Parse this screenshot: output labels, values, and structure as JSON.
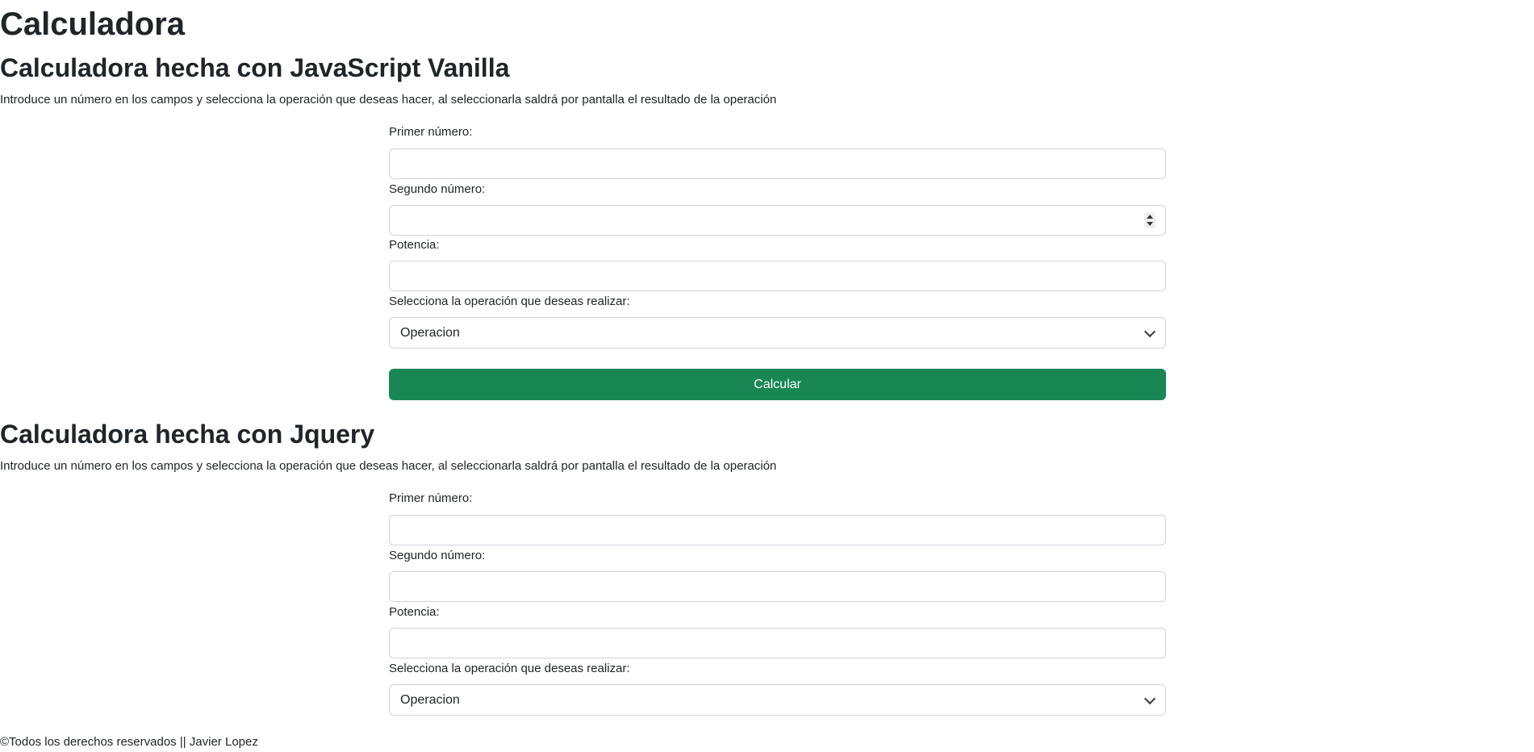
{
  "page": {
    "title": "Calculadora"
  },
  "vanilla": {
    "heading": "Calculadora hecha con JavaScript Vanilla",
    "description": "Introduce un número en los campos y selecciona la operación que deseas hacer, al seleccionarla saldrá por pantalla el resultado de la operación",
    "first_label": "Primer número:",
    "first_value": "",
    "second_label": "Segundo número:",
    "second_value": "",
    "power_label": "Potencia:",
    "power_value": "",
    "operation_label": "Selecciona la operación que deseas realizar:",
    "operation_selected": "Operacion",
    "submit_label": "Calcular"
  },
  "jquery": {
    "heading": "Calculadora hecha con Jquery",
    "description": "Introduce un número en los campos y selecciona la operación que deseas hacer, al seleccionarla saldrá por pantalla el resultado de la operación",
    "first_label": "Primer número:",
    "first_value": "",
    "second_label": "Segundo número:",
    "second_value": "",
    "power_label": "Potencia:",
    "power_value": "",
    "operation_label": "Selecciona la operación que deseas realizar:",
    "operation_selected": "Operacion"
  },
  "footer": {
    "text": "©Todos los derechos reservados || Javier Lopez"
  },
  "colors": {
    "button_bg": "#198754",
    "button_text": "#ffffff",
    "border": "#ced4da",
    "text": "#212529"
  },
  "icons": {
    "select_arrow": "chevron-down-icon",
    "number_spinner": "spinner-arrows-icon"
  }
}
